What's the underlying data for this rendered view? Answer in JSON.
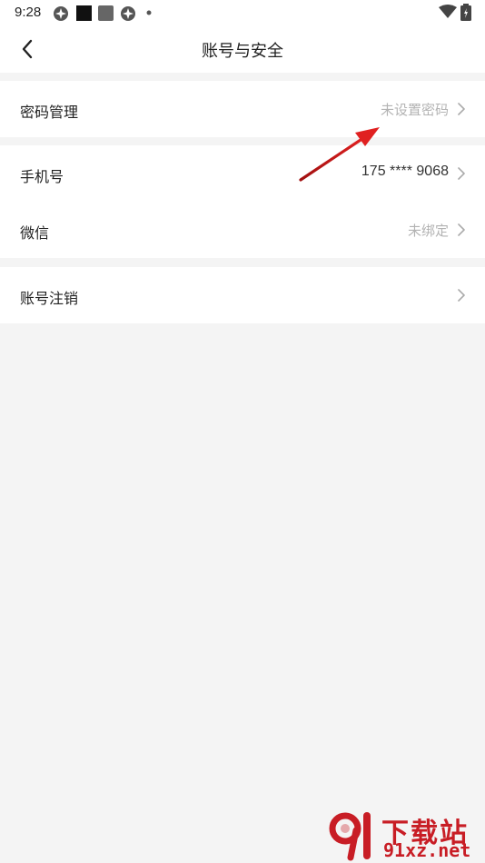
{
  "status_bar": {
    "time": "9:28",
    "icons": [
      "app-notification-icon",
      "black-square-icon",
      "gray-square-icon",
      "app-notification-icon",
      "dot-icon",
      "wifi-icon",
      "battery-icon"
    ]
  },
  "header": {
    "title": "账号与安全",
    "back_icon": "chevron-left-icon"
  },
  "groups": [
    {
      "items": [
        {
          "label": "密码管理",
          "value": "未设置密码"
        }
      ]
    },
    {
      "items": [
        {
          "label": "手机号",
          "value": "175 **** 9068"
        },
        {
          "label": "微信",
          "value": "未绑定"
        }
      ]
    },
    {
      "items": [
        {
          "label": "账号注销",
          "value": ""
        }
      ]
    }
  ],
  "colors": {
    "background": "#f4f4f4",
    "surface": "#ffffff",
    "muted_text": "#b3b3b3",
    "annotation_arrow": "#d81e1e",
    "watermark": "#c81d25"
  },
  "watermark": {
    "logo": "91-logo",
    "name": "下载站",
    "domain": "91xz.net"
  }
}
